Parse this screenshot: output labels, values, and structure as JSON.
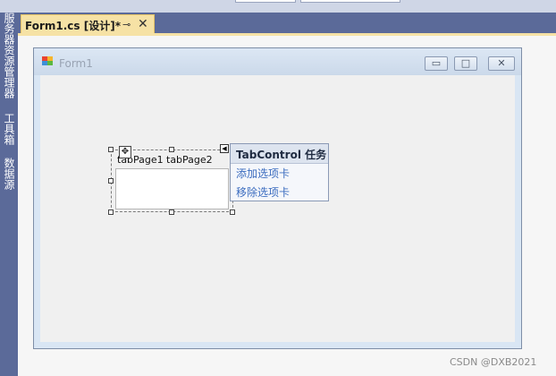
{
  "sidebar": {
    "tabs": [
      {
        "label": "服务器资源管理器"
      },
      {
        "label": "工具箱"
      },
      {
        "label": "数据源"
      }
    ]
  },
  "document_tab": {
    "title": "Form1.cs [设计]*",
    "pin_icon": "pin-icon",
    "close_icon": "close-icon"
  },
  "form": {
    "title": "Form1",
    "buttons": {
      "minimize": "minimize-icon",
      "maximize": "maximize-icon",
      "close": "close-icon"
    }
  },
  "tab_control": {
    "tabs": [
      {
        "label": "tabPage1"
      },
      {
        "label": "tabPage2"
      }
    ]
  },
  "task_panel": {
    "title": "TabControl 任务",
    "actions": [
      {
        "label": "添加选项卡"
      },
      {
        "label": "移除选项卡"
      }
    ]
  },
  "watermark": "CSDN @DXB2021",
  "colors": {
    "ide_frame": "#5b6a99",
    "active_tab": "#f6e2a5",
    "form_border": "#d9e6f4",
    "link": "#3b6cbf"
  }
}
